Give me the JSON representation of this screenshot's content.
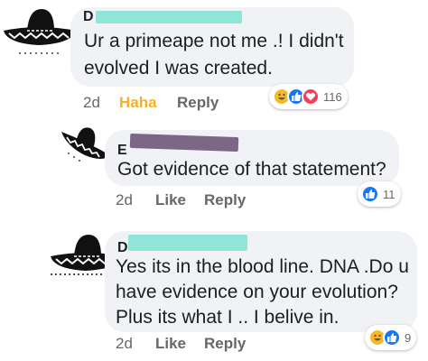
{
  "colors": {
    "bubble": "#f0f2f5",
    "meta_text": "#65676b",
    "haha_active": "#f7b125",
    "like_blue": "#1877f2",
    "love_red": "#f33e58",
    "haha_yellow": "#f7b928",
    "redact_teal": "#8fe6d8",
    "redact_purple": "#7c6787"
  },
  "comments": [
    {
      "name_fragment": "D",
      "avatar": "sombrero-icon",
      "lines": [
        "Ur a primeape not me .! I didn't",
        "evolved I was created."
      ],
      "time": "2d",
      "actions": [
        "Haha",
        "Reply"
      ],
      "reactions": [
        "haha-icon",
        "like-icon",
        "love-icon"
      ],
      "reaction_count": "116"
    },
    {
      "name_fragment": "E",
      "avatar": "sombrero-icon",
      "lines": [
        "Got evidence of that statement?"
      ],
      "time": "2d",
      "actions": [
        "Like",
        "Reply"
      ],
      "reactions": [
        "like-icon"
      ],
      "reaction_count": "11"
    },
    {
      "name_fragment": "D",
      "avatar": "sombrero-icon",
      "lines": [
        "Yes its in the blood line. DNA .Do u",
        "have evidence on your evolution?",
        "Plus its what I .. I belive in."
      ],
      "time": "2d",
      "actions": [
        "Like",
        "Reply"
      ],
      "reactions": [
        "haha-icon",
        "like-icon"
      ],
      "reaction_count": "9"
    }
  ]
}
